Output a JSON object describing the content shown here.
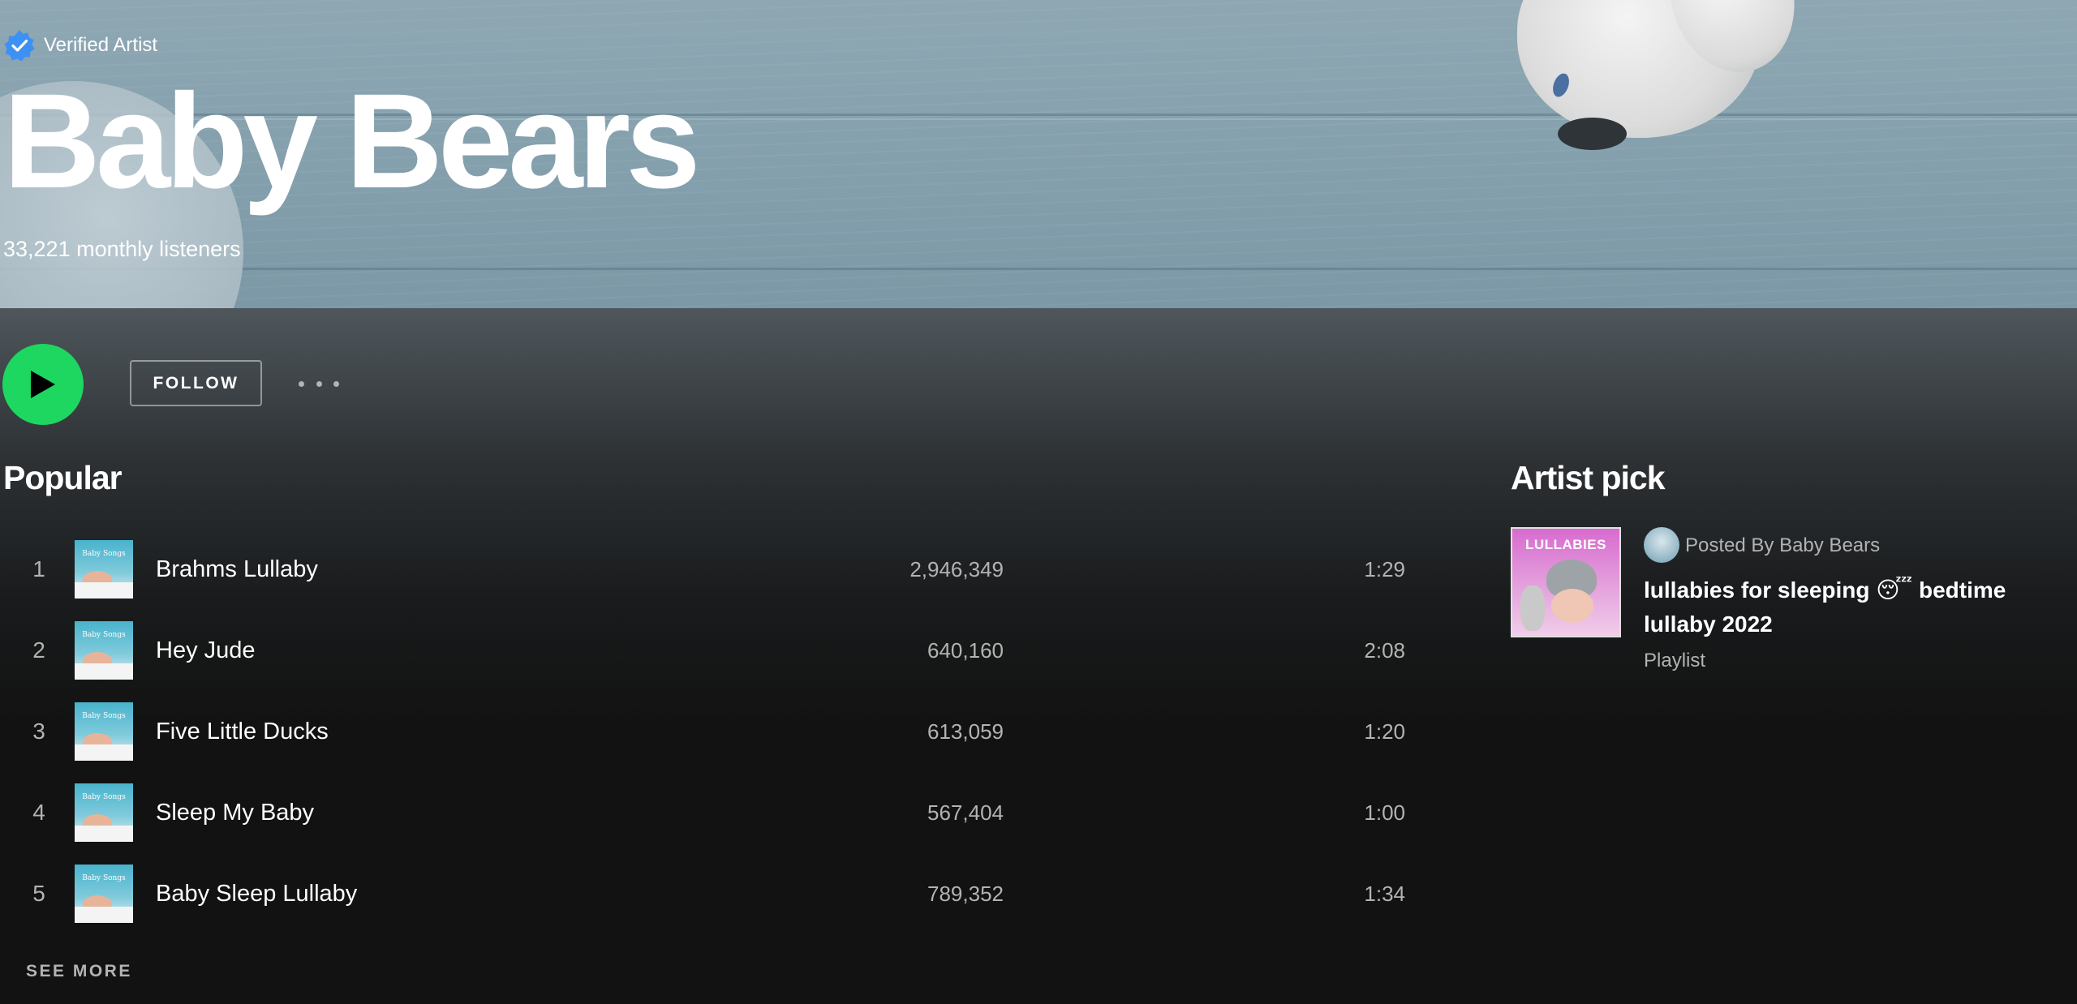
{
  "artist": {
    "verified_label": "Verified Artist",
    "name": "Baby Bears",
    "monthly_listeners": "33,221 monthly listeners"
  },
  "actions": {
    "follow_label": "FOLLOW"
  },
  "popular": {
    "title": "Popular",
    "tracks": [
      {
        "number": "1",
        "title": "Brahms Lullaby",
        "plays": "2,946,349",
        "duration": "1:29",
        "cover_text": "Baby Songs"
      },
      {
        "number": "2",
        "title": "Hey Jude",
        "plays": "640,160",
        "duration": "2:08",
        "cover_text": "Baby Songs"
      },
      {
        "number": "3",
        "title": "Five Little Ducks",
        "plays": "613,059",
        "duration": "1:20",
        "cover_text": "Baby Songs"
      },
      {
        "number": "4",
        "title": "Sleep My Baby",
        "plays": "567,404",
        "duration": "1:00",
        "cover_text": "Baby Songs"
      },
      {
        "number": "5",
        "title": "Baby Sleep Lullaby",
        "plays": "789,352",
        "duration": "1:34",
        "cover_text": "Baby Songs"
      }
    ],
    "see_more_label": "SEE MORE"
  },
  "artist_pick": {
    "title": "Artist pick",
    "cover_text": "LULLABIES",
    "posted_by": "Posted By Baby Bears",
    "playlist_title": "lullabies for sleeping 😴 bedtime lullaby 2022",
    "playlist_type": "Playlist"
  },
  "colors": {
    "accent_green": "#1ed760",
    "background": "#121212",
    "secondary_text": "#b3b3b3",
    "verified_blue": "#3d91f4"
  },
  "icons": [
    "verified-badge-icon",
    "play-icon",
    "more-options-icon"
  ]
}
